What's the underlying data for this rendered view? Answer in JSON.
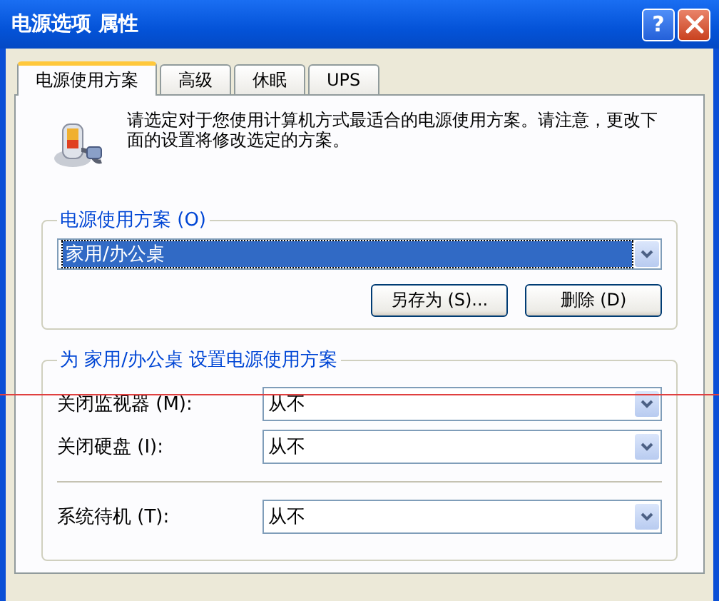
{
  "window": {
    "title": "电源选项 属性",
    "help": "?"
  },
  "tabs": [
    {
      "label": "电源使用方案",
      "selected": true
    },
    {
      "label": "高级",
      "selected": false
    },
    {
      "label": "休眠",
      "selected": false
    },
    {
      "label": "UPS",
      "selected": false
    }
  ],
  "description": "请选定对于您使用计算机方式最适合的电源使用方案。请注意，更改下面的设置将修改选定的方案。",
  "scheme": {
    "label": "电源使用方案 (O)",
    "value": "家用/办公桌",
    "buttons": [
      "另存为 (S)...",
      "删除 (D)"
    ]
  },
  "settings": {
    "title": "为 家用/办公桌 设置电源使用方案",
    "rows": [
      {
        "label": "关闭监视器 (M):",
        "value": "从不",
        "divider_before": false
      },
      {
        "label": "关闭硬盘 (I):",
        "value": "从不",
        "divider_before": false
      },
      {
        "label": "系统待机 (T):",
        "value": "从不",
        "divider_before": true
      }
    ]
  }
}
